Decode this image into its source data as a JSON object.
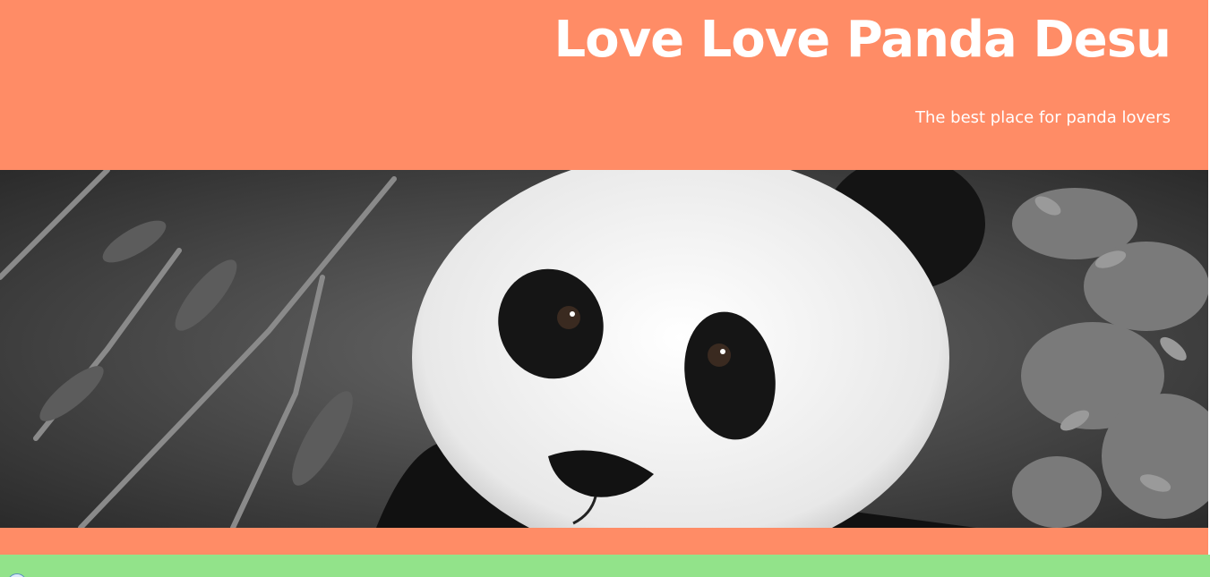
{
  "header": {
    "title": "Love Love Panda Desu",
    "tagline": "The best place for panda lovers"
  },
  "hero": {
    "icon": "panda-photo"
  },
  "footer": {
    "icon": "globe-icon"
  },
  "colors": {
    "header_bg": "#ff8c66",
    "footer_bg": "#92e38a",
    "title_text": "#ffffff"
  }
}
